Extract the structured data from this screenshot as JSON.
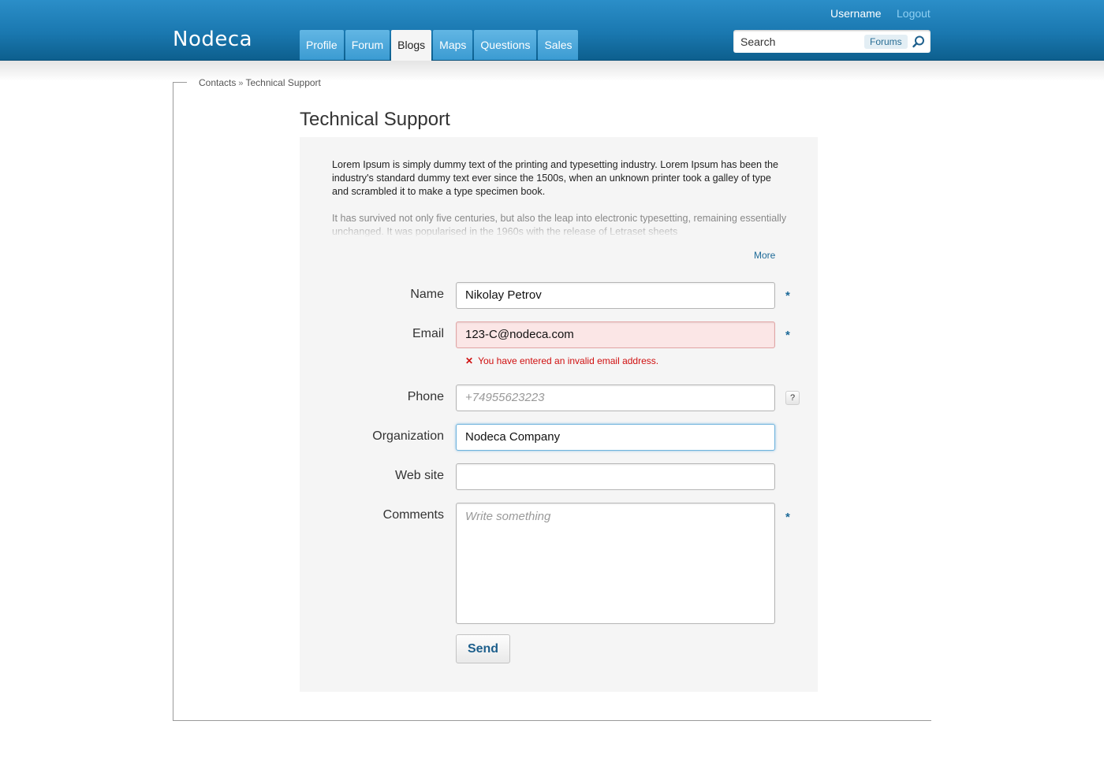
{
  "header": {
    "logo": "Nodeca",
    "username": "Username",
    "logout": "Logout",
    "tabs": [
      {
        "label": "Profile"
      },
      {
        "label": "Forum"
      },
      {
        "label": "Blogs",
        "active": true
      },
      {
        "label": "Maps"
      },
      {
        "label": "Questions"
      },
      {
        "label": "Sales"
      }
    ],
    "search": {
      "text": "Search",
      "scope": "Forums",
      "icon": "search-icon"
    }
  },
  "breadcrumb": {
    "items": [
      "Contacts",
      "Technical Support"
    ],
    "separator": "»"
  },
  "page": {
    "title": "Technical Support",
    "intro_1": "Lorem Ipsum is simply dummy text of the printing and typesetting industry. Lorem Ipsum has been the industry's standard dummy text ever since the 1500s, when an unknown printer took a galley of type and scrambled it to make a type specimen book.",
    "intro_2": "It has survived not only five centuries, but also the leap into electronic typesetting, remaining essentially unchanged. It was popularised in the 1960s with the release of Letraset sheets",
    "more": "More"
  },
  "form": {
    "name": {
      "label": "Name",
      "value": "Nikolay Petrov",
      "required": "*"
    },
    "email": {
      "label": "Email",
      "value": "123-C@nodeca.com",
      "required": "*",
      "error": "You have entered an invalid email address.",
      "error_icon": "✕"
    },
    "phone": {
      "label": "Phone",
      "placeholder": "+74955623223",
      "help": "?"
    },
    "organization": {
      "label": "Organization",
      "value": "Nodeca Company"
    },
    "website": {
      "label": "Web site",
      "value": ""
    },
    "comments": {
      "label": "Comments",
      "placeholder": "Write something",
      "required": "*"
    },
    "send": "Send"
  },
  "colors": {
    "header": "#1a78b0",
    "accent": "#1d6a98",
    "error": "#d01010",
    "panel": "#f5f5f5"
  }
}
